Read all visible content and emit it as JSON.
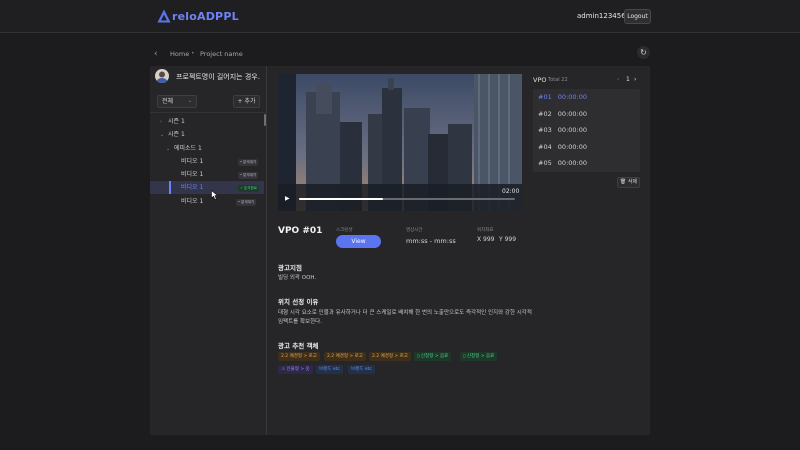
{
  "header": {
    "brand": "reloADPPL",
    "user": "admin123456...",
    "logout_label": "Logout"
  },
  "breadcrumb": {
    "home": "Home",
    "separator": "•",
    "project": "Project name"
  },
  "project": {
    "title": "프로젝트명이 길어지는 경우..."
  },
  "filter": {
    "selected": "전체",
    "add_label": "+ 추가"
  },
  "tree": [
    {
      "label": "시즌 1",
      "level": 1,
      "expanded": false
    },
    {
      "label": "시즌 1",
      "level": 1,
      "expanded": true
    },
    {
      "label": "에피소드 1",
      "level": 2,
      "expanded": true
    },
    {
      "label": "비디오 1",
      "level": 3,
      "tag": "• 분석대기"
    },
    {
      "label": "비디오 1",
      "level": 3,
      "tag": "• 분석대기"
    },
    {
      "label": "비디오 1",
      "level": 3,
      "tag": "✓ 분석완료",
      "selected": true
    },
    {
      "label": "비디오 1",
      "level": 3,
      "tag": "• 분석대기"
    }
  ],
  "video": {
    "time": "02:00",
    "progress": 0.39
  },
  "vpo": {
    "label": "VPO",
    "total": "Total 22",
    "page": "1",
    "items": [
      {
        "id": "#01",
        "time": "00:00:00",
        "active": true
      },
      {
        "id": "#02",
        "time": "00:00:00"
      },
      {
        "id": "#03",
        "time": "00:00:00"
      },
      {
        "id": "#04",
        "time": "00:00:00"
      },
      {
        "id": "#05",
        "time": "00:00:00"
      }
    ],
    "delete_label": "삭제"
  },
  "detail": {
    "title": "VPO #01",
    "screenshot_label": "스크린샷",
    "view_label": "View",
    "time_label": "영상시간",
    "time_value": "mm:ss - mm:ss",
    "position_label": "위치좌표",
    "x_value": "X 999",
    "y_value": "Y 999",
    "ad_spot_title": "광고지점",
    "ad_spot_text": "빌딩 외곽 OOH.",
    "reason_title": "위치 선정 이유",
    "reason_text": "대형 시각 요소로 인물과 유사하거나 더 큰 스케일로 배치해 한 번의 노출만으로도 즉각적인 인지와 강한 시각적 임팩트를 확보한다.",
    "reco_title": "광고 추천 객체"
  },
  "chips": [
    {
      "label": "2.2 예경형 > 로고",
      "color": "orange"
    },
    {
      "label": "2.2 예경형 > 로고",
      "color": "orange"
    },
    {
      "label": "2.2 예경형 > 로고",
      "color": "orange"
    },
    {
      "label": "▯ 신청형 > 음료",
      "color": "green"
    },
    {
      "label": "▯ 신청형 > 음료",
      "color": "green"
    },
    {
      "label": "⚠ 인물형 > 옷",
      "color": "purple"
    },
    {
      "label": "브랜드 etc",
      "color": "blue"
    },
    {
      "label": "브랜드 etc",
      "color": "blue"
    }
  ]
}
